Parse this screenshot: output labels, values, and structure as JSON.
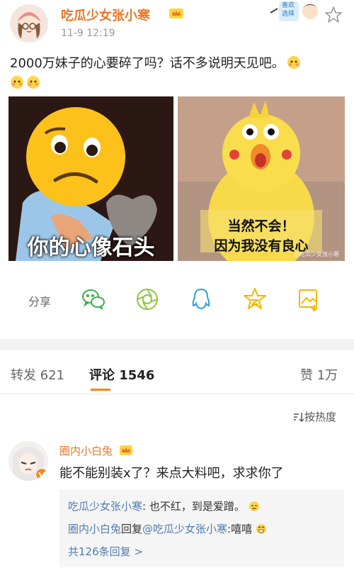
{
  "post": {
    "author": "吃瓜少女张小寒",
    "time": "11-9 12:19",
    "text": "2000万妹子的心要碎了吗？话不多说明天见吧。",
    "badge_text": [
      "喜欢",
      "选择"
    ],
    "images": [
      {
        "caption": "你的心像石头"
      },
      {
        "caption_line1": "当然不会！",
        "caption_line2": "因为我没有良心",
        "watermark": "@吃瓜少女张小寒"
      }
    ]
  },
  "share": {
    "label": "分享",
    "icons": [
      "wechat-icon",
      "moments-icon",
      "qq-icon",
      "qzone-star-icon",
      "save-image-icon"
    ]
  },
  "tabs": {
    "repost": "转发 621",
    "comments": "评论 1546",
    "likes": "赞 1万"
  },
  "sort": {
    "label": "按热度"
  },
  "comment": {
    "author": "圈内小白兔",
    "text": "能不能别装x了？来点大料吧，求求你了",
    "replies": [
      {
        "name": "吃瓜少女张小寒",
        "text": ": 也不红，到是爱蹭。"
      },
      {
        "name": "圈内小白兔",
        "mid": "回复",
        "mention": "@吃瓜少女张小寒",
        "text": ":嘻嘻"
      }
    ],
    "more": "共126条回复 >"
  },
  "colors": {
    "accent": "#e8772a",
    "link": "#507daf",
    "tab_indicator": "#ff8200"
  }
}
